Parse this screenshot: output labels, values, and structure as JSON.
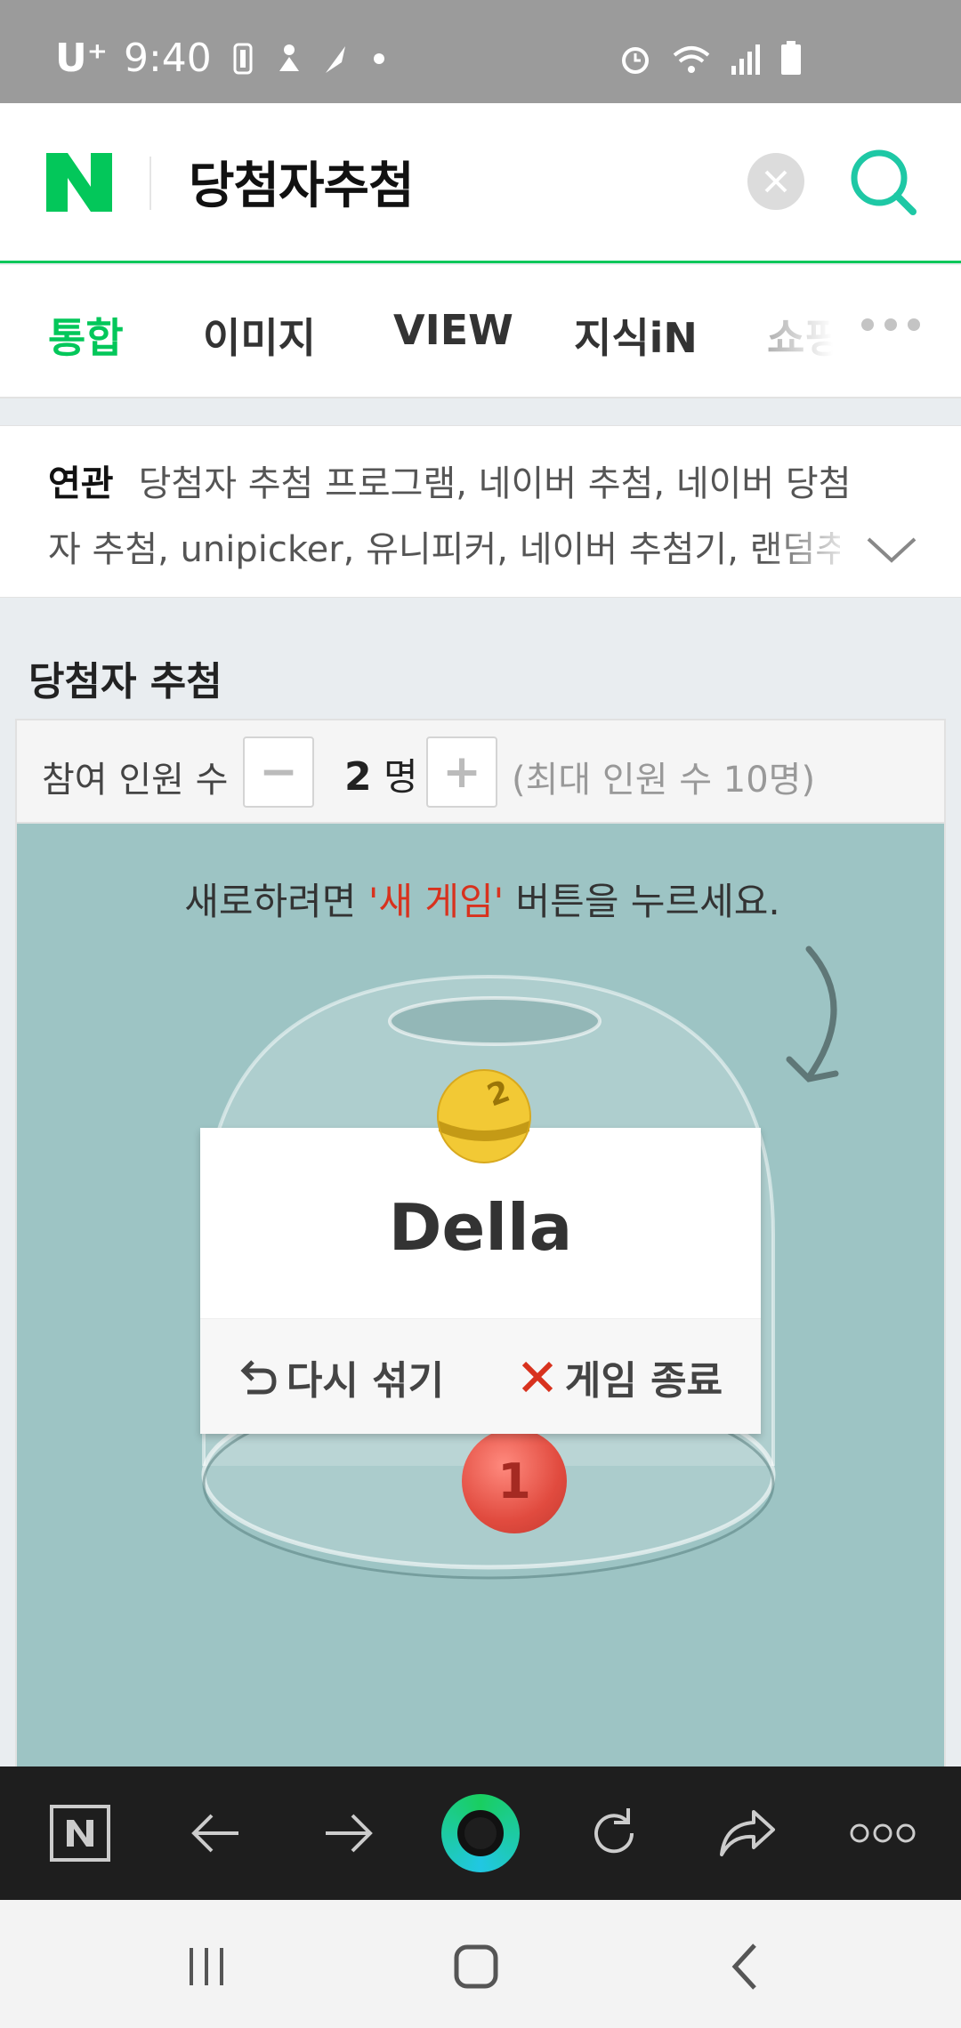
{
  "status_bar": {
    "carrier": "U⁺",
    "time": "9:40"
  },
  "search": {
    "query": "당첨자추첨",
    "logo_text": "N"
  },
  "tabs": [
    {
      "label": "통합",
      "active": true
    },
    {
      "label": "이미지",
      "active": false
    },
    {
      "label": "VIEW",
      "active": false
    },
    {
      "label": "지식iN",
      "active": false
    },
    {
      "label": "쇼핑",
      "active": false
    }
  ],
  "related": {
    "title": "연관",
    "line1": "당첨자 추첨 프로그램, 네이버 추첨, 네이버 당첨",
    "line2": "자 추첨, unipicker, 유니피커, 네이버 추첨기, 랜덤추첨"
  },
  "picker": {
    "section_title": "당첨자 추첨",
    "participants_label": "참여 인원 수",
    "minus": "−",
    "plus": "+",
    "count": "2",
    "count_unit": "명",
    "max_note": "(최대 인원 수 10명)",
    "hint_before": "새로하려면 ",
    "hint_em": "'새 게임'",
    "hint_after": " 버튼을 누르세요.",
    "winner": "Della",
    "yellow_ball_number": "2",
    "red_ball_number": "1",
    "reshuffle_label": "다시 섞기",
    "end_game_label": "게임 종료"
  },
  "colors": {
    "naver_green": "#03c75a",
    "game_bg": "#9dc4c4",
    "accent_red": "#d8321e",
    "toolbar_bg": "#1e1e1e"
  }
}
